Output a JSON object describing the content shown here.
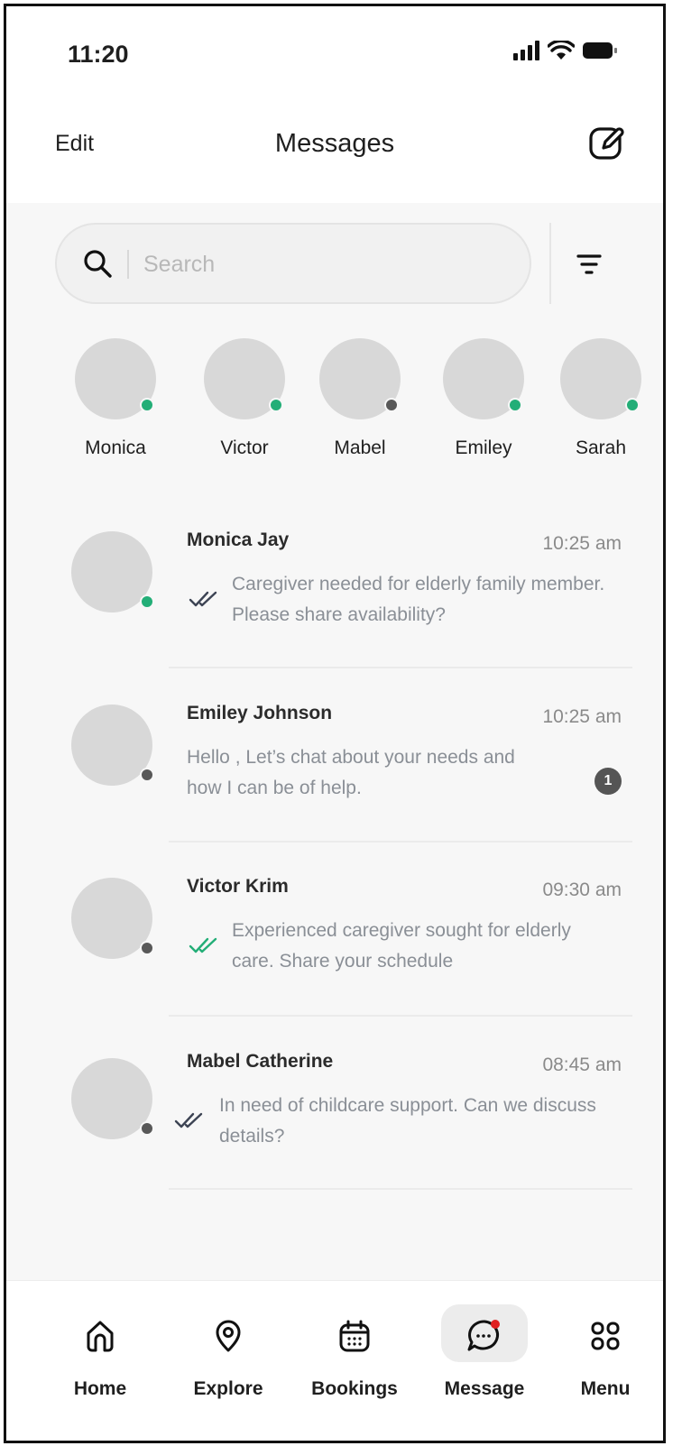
{
  "status": {
    "time": "11:20"
  },
  "header": {
    "edit_label": "Edit",
    "title": "Messages",
    "compose_icon": "compose-icon"
  },
  "search": {
    "placeholder": "Search",
    "icon": "search-icon",
    "filter_icon": "filter-icon"
  },
  "stories": [
    {
      "name": "Monica",
      "online": true
    },
    {
      "name": "Victor",
      "online": true
    },
    {
      "name": "Mabel",
      "online": false
    },
    {
      "name": "Emiley",
      "online": true
    },
    {
      "name": "Sarah",
      "online": true
    }
  ],
  "conversations": [
    {
      "name": "Monica Jay",
      "time": "10:25 am",
      "message": "Caregiver needed for elderly family member. Please share availability?",
      "online": true,
      "read_status": "sent",
      "unread": ""
    },
    {
      "name": "Emiley Johnson",
      "time": "10:25 am",
      "message": "Hello , Let’s chat about your needs and how I can be of help.",
      "online": false,
      "read_status": "",
      "unread": "1"
    },
    {
      "name": "Victor Krim",
      "time": "09:30 am",
      "message": "Experienced caregiver sought for elderly care. Share your schedule",
      "online": false,
      "read_status": "read",
      "unread": ""
    },
    {
      "name": "Mabel Catherine",
      "time": "08:45 am",
      "message": "In need of childcare support. Can we discuss details?",
      "online": false,
      "read_status": "sent",
      "unread": ""
    }
  ],
  "tabs": [
    {
      "label": "Home",
      "icon": "home-icon"
    },
    {
      "label": "Explore",
      "icon": "location-pin-icon"
    },
    {
      "label": "Bookings",
      "icon": "calendar-icon"
    },
    {
      "label": "Message",
      "icon": "chat-icon",
      "active": true
    },
    {
      "label": "Menu",
      "icon": "grid-icon"
    }
  ],
  "colors": {
    "online": "#23ae77",
    "offline": "#585858",
    "read_ticks": "#23ae77",
    "sent_ticks": "#3d4454",
    "notification_dot": "#e02020"
  }
}
